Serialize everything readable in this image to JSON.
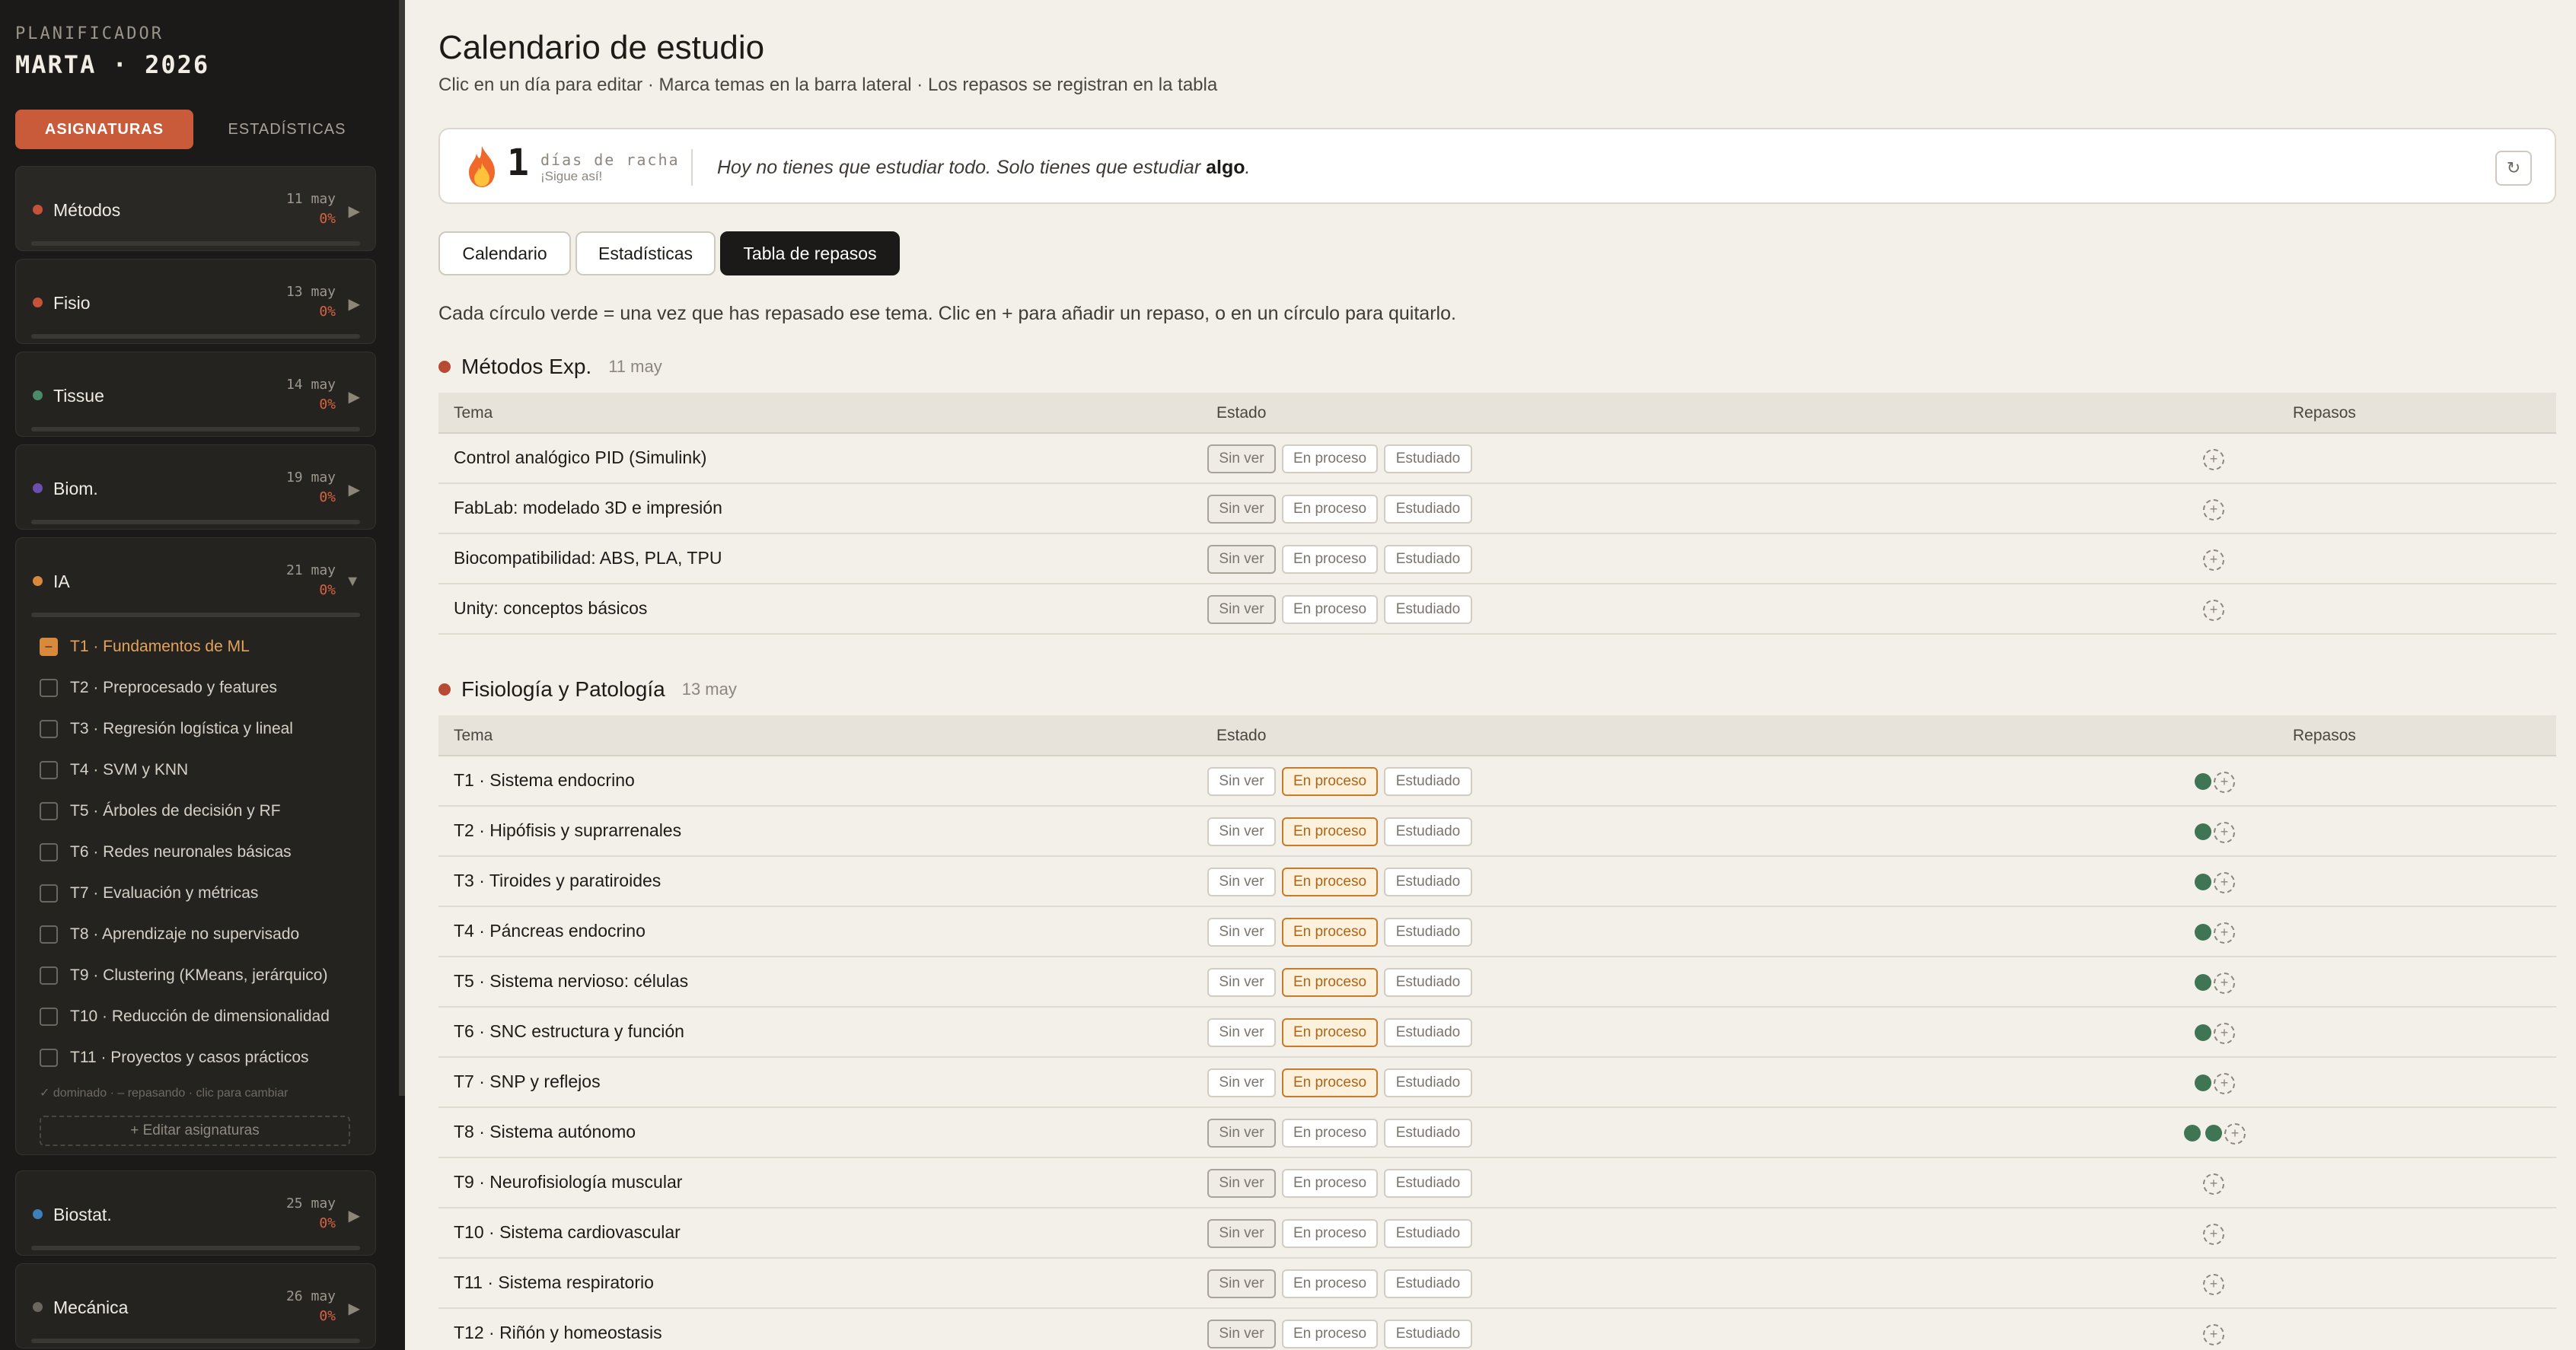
{
  "sidebar": {
    "kicker": "PLANIFICADOR",
    "title": "MARTA · 2026",
    "tab_active": "ASIGNATURAS",
    "tab_inactive": "ESTADÍSTICAS",
    "subjects": [
      {
        "name": "Métodos",
        "date": "11 may",
        "pct": "0%",
        "color": "#c65239"
      },
      {
        "name": "Fisio",
        "date": "13 may",
        "pct": "0%",
        "color": "#c65239"
      },
      {
        "name": "Tissue",
        "date": "14 may",
        "pct": "0%",
        "color": "#4a8a6a"
      },
      {
        "name": "Biom.",
        "date": "19 may",
        "pct": "0%",
        "color": "#6a4fb0"
      },
      {
        "name": "IA",
        "date": "21 may",
        "pct": "0%",
        "color": "#d9893c"
      },
      {
        "name": "Biostat.",
        "date": "25 may",
        "pct": "0%",
        "color": "#3d7fb8"
      },
      {
        "name": "Mecánica",
        "date": "26 may",
        "pct": "0%",
        "color": "#6b665e"
      }
    ],
    "ia_topics": [
      {
        "label": "T1 · Fundamentos de ML",
        "state": "partial",
        "mark": "–"
      },
      {
        "label": "T2 · Preprocesado y features",
        "state": "none",
        "mark": ""
      },
      {
        "label": "T3 · Regresión logística y lineal",
        "state": "none",
        "mark": ""
      },
      {
        "label": "T4 · SVM y KNN",
        "state": "none",
        "mark": ""
      },
      {
        "label": "T5 · Árboles de decisión y RF",
        "state": "none",
        "mark": ""
      },
      {
        "label": "T6 · Redes neuronales básicas",
        "state": "none",
        "mark": ""
      },
      {
        "label": "T7 · Evaluación y métricas",
        "state": "none",
        "mark": ""
      },
      {
        "label": "T8 · Aprendizaje no supervisado",
        "state": "none",
        "mark": ""
      },
      {
        "label": "T9 · Clustering (KMeans, jerárquico)",
        "state": "none",
        "mark": ""
      },
      {
        "label": "T10 · Reducción de dimensionalidad",
        "state": "none",
        "mark": ""
      },
      {
        "label": "T11 · Proyectos y casos prácticos",
        "state": "none",
        "mark": ""
      }
    ],
    "legend": "✓ dominado · – repasando · clic para cambiar",
    "edit_label": "+ Editar asignaturas",
    "arrow_closed": "▶",
    "arrow_open": "▼"
  },
  "main": {
    "title": "Calendario de estudio",
    "subtitle": "Clic en un día para editar · Marca temas en la barra lateral · Los repasos se registran en la tabla",
    "streak": {
      "number": "1",
      "label": "días de racha",
      "sub": "¡Sigue así!",
      "quote_pre": "Hoy no tienes que estudiar todo. Solo tienes que estudiar ",
      "quote_bold": "algo",
      "quote_post": ".",
      "refresh_icon": "↻"
    },
    "tabs": [
      "Calendario",
      "Estadísticas",
      "Tabla de repasos"
    ],
    "helper": "Cada círculo verde = una vez que has repasado ese tema. Clic en + para añadir un repaso, o en un círculo para quitarlo.",
    "columns": {
      "tema": "Tema",
      "estado": "Estado",
      "repasos": "Repasos"
    },
    "pill_labels": [
      "Sin ver",
      "En proceso",
      "Estudiado"
    ],
    "add_icon": "+",
    "sections": [
      {
        "title": "Métodos Exp.",
        "date": "11 may",
        "rows": [
          {
            "name": "Control analógico PID (Simulink)",
            "status": "sin",
            "reps": 0
          },
          {
            "name": "FabLab: modelado 3D e impresión",
            "status": "sin",
            "reps": 0
          },
          {
            "name": "Biocompatibilidad: ABS, PLA, TPU",
            "status": "sin",
            "reps": 0
          },
          {
            "name": "Unity: conceptos básicos",
            "status": "sin",
            "reps": 0
          }
        ]
      },
      {
        "title": "Fisiología y Patología",
        "date": "13 may",
        "rows": [
          {
            "name": "T1 · Sistema endocrino",
            "status": "proc",
            "reps": 1
          },
          {
            "name": "T2 · Hipófisis y suprarrenales",
            "status": "proc",
            "reps": 1
          },
          {
            "name": "T3 · Tiroides y paratiroides",
            "status": "proc",
            "reps": 1
          },
          {
            "name": "T4 · Páncreas endocrino",
            "status": "proc",
            "reps": 1
          },
          {
            "name": "T5 · Sistema nervioso: células",
            "status": "proc",
            "reps": 1
          },
          {
            "name": "T6 · SNC estructura y función",
            "status": "proc",
            "reps": 1
          },
          {
            "name": "T7 · SNP y reflejos",
            "status": "proc",
            "reps": 1
          },
          {
            "name": "T8 · Sistema autónomo",
            "status": "sin",
            "reps": 2
          },
          {
            "name": "T9 · Neurofisiología muscular",
            "status": "sin",
            "reps": 0
          },
          {
            "name": "T10 · Sistema cardiovascular",
            "status": "sin",
            "reps": 0
          },
          {
            "name": "T11 · Sistema respiratorio",
            "status": "sin",
            "reps": 0
          },
          {
            "name": "T12 · Riñón y homeostasis",
            "status": "sin",
            "reps": 0
          }
        ]
      }
    ]
  }
}
